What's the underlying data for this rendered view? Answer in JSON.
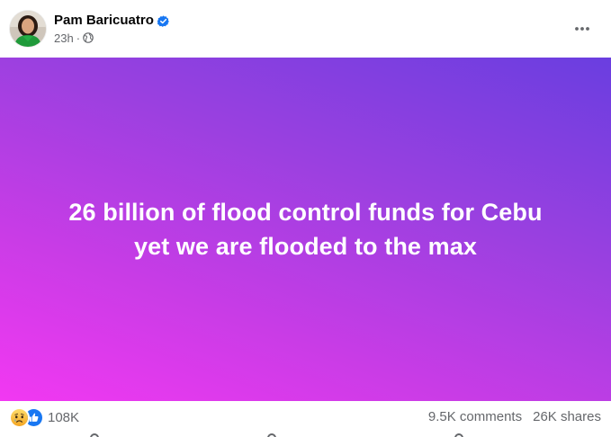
{
  "post": {
    "author": {
      "name": "Pam Baricuatro",
      "verified": true,
      "avatar_icon": "profile-photo"
    },
    "meta": {
      "time": "23h",
      "separator": "·",
      "audience_icon": "globe-icon"
    },
    "more_icon": "more-horizontal-icon",
    "body": {
      "line1": "26 billion of flood control funds for Cebu",
      "line2": "yet we are flooded to the max",
      "gradient_colors": [
        "#f238f2",
        "#c93ce6",
        "#9b40e0",
        "#6a3ee0"
      ]
    },
    "stats": {
      "reaction_icons": [
        "sad-reaction-icon",
        "like-reaction-icon"
      ],
      "reaction_count": "108K",
      "comments": "9.5K comments",
      "shares": "26K shares"
    }
  },
  "colors": {
    "text_primary": "#050505",
    "text_secondary": "#65676b",
    "verified_blue": "#1877f2",
    "like_blue": "#1877f2",
    "sad_yellow": "#f7b125"
  }
}
